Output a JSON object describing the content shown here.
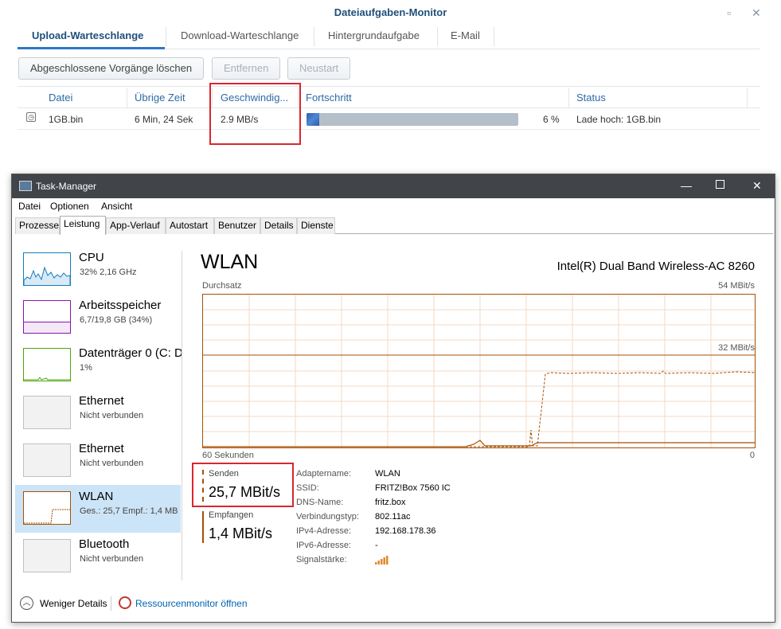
{
  "dialog": {
    "title": "Dateiaufgaben-Monitor",
    "tabs": [
      "Upload-Warteschlange",
      "Download-Warteschlange",
      "Hintergrundaufgabe",
      "E-Mail"
    ],
    "buttons": {
      "clear": "Abgeschlossene Vorgänge löschen",
      "remove": "Entfernen",
      "restart": "Neustart"
    },
    "columns": [
      "Datei",
      "Übrige Zeit",
      "Geschwindig...",
      "Fortschritt",
      "Status"
    ],
    "row": {
      "file": "1GB.bin",
      "remaining": "6 Min, 24 Sek",
      "speed": "2.9 MB/s",
      "progress_pct": 6,
      "progress_text": "6 %",
      "status": "Lade hoch: 1GB.bin"
    }
  },
  "taskmanager": {
    "title": "Task-Manager",
    "menu": [
      "Datei",
      "Optionen",
      "Ansicht"
    ],
    "tabs": [
      "Prozesse",
      "Leistung",
      "App-Verlauf",
      "Autostart",
      "Benutzer",
      "Details",
      "Dienste"
    ],
    "sidebar": [
      {
        "name": "CPU",
        "sub": "32% 2,16 GHz",
        "color": "#117dbb"
      },
      {
        "name": "Arbeitsspeicher",
        "sub": "6,7/19,8 GB (34%)",
        "color": "#8b12ae"
      },
      {
        "name": "Datenträger 0 (C: D",
        "sub": "1%",
        "color": "#4da60c"
      },
      {
        "name": "Ethernet",
        "sub": "Nicht verbunden",
        "color": "#a74f01"
      },
      {
        "name": "Ethernet",
        "sub": "Nicht verbunden",
        "color": "#a74f01"
      },
      {
        "name": "WLAN",
        "sub": "Ges.: 25,7 Empf.: 1,4 MB",
        "color": "#a74f01"
      },
      {
        "name": "Bluetooth",
        "sub": "Nicht verbunden",
        "color": "#a74f01"
      }
    ],
    "panel": {
      "title": "WLAN",
      "adapter_model": "Intel(R) Dual Band Wireless-AC 8260",
      "graph_label": "Durchsatz",
      "graph_max": "54 MBit/s",
      "graph_mid": "32 MBit/s",
      "graph_time": "60 Sekunden",
      "graph_zero": "0",
      "send_label": "Senden",
      "send_value": "25,7 MBit/s",
      "recv_label": "Empfangen",
      "recv_value": "1,4 MBit/s",
      "details": [
        {
          "k": "Adaptername:",
          "v": "WLAN"
        },
        {
          "k": "SSID:",
          "v": "FRITZ!Box 7560 IC"
        },
        {
          "k": "DNS-Name:",
          "v": "fritz.box"
        },
        {
          "k": "Verbindungstyp:",
          "v": "802.11ac"
        },
        {
          "k": "IPv4-Adresse:",
          "v": "192.168.178.36"
        },
        {
          "k": "IPv6-Adresse:",
          "v": "-"
        },
        {
          "k": "Signalstärke:",
          "v": ""
        }
      ]
    },
    "footer": {
      "less_details": "Weniger Details",
      "resmon": "Ressourcenmonitor öffnen"
    },
    "accent": "#a74f01"
  }
}
